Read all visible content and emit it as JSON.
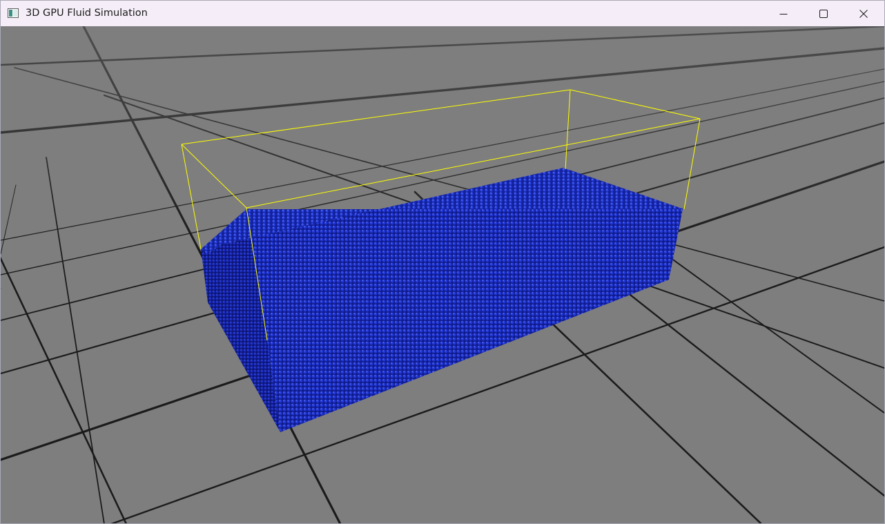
{
  "window": {
    "title": "3D GPU Fluid Simulation",
    "icon": "app-window-icon",
    "controls": {
      "minimize_icon": "minimize-icon",
      "maximize_icon": "maximize-icon",
      "close_icon": "close-icon"
    }
  },
  "scene": {
    "background_color": "#7e7e7e",
    "grid_color": "#1b1b1b",
    "boundary_box_color": "#ffff00",
    "fluid_particle_color": "#1a2bc4"
  }
}
